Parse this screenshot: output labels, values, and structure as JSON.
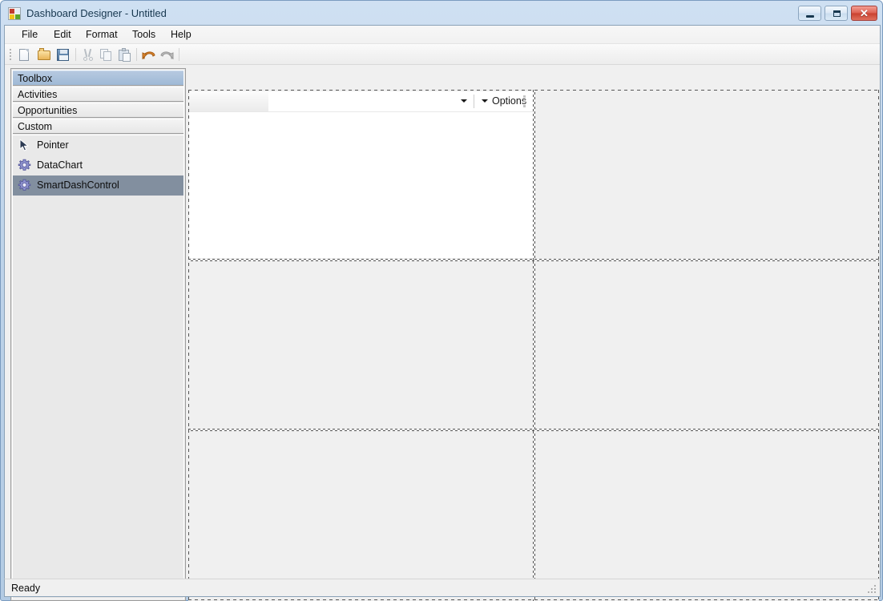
{
  "window": {
    "title": "Dashboard Designer - Untitled",
    "icon": "dashboard-app-icon",
    "controls": {
      "minimize": "Minimize",
      "maximize": "Maximize",
      "close": "Close"
    }
  },
  "menu": {
    "items": [
      {
        "label": "File"
      },
      {
        "label": "Edit"
      },
      {
        "label": "Format"
      },
      {
        "label": "Tools"
      },
      {
        "label": "Help"
      }
    ]
  },
  "toolbar": {
    "buttons": [
      {
        "icon": "new-document-icon",
        "tooltip": "New"
      },
      {
        "icon": "open-folder-icon",
        "tooltip": "Open"
      },
      {
        "icon": "save-floppy-icon",
        "tooltip": "Save"
      },
      {
        "icon": "cut-scissors-icon",
        "tooltip": "Cut"
      },
      {
        "icon": "copy-icon",
        "tooltip": "Copy"
      },
      {
        "icon": "paste-icon",
        "tooltip": "Paste"
      },
      {
        "icon": "undo-arrow-icon",
        "tooltip": "Undo"
      },
      {
        "icon": "redo-arrow-icon",
        "tooltip": "Redo"
      }
    ]
  },
  "toolbox": {
    "sections": [
      {
        "label": "Toolbox",
        "active": true
      },
      {
        "label": "Activities",
        "active": false
      },
      {
        "label": "Opportunities",
        "active": false
      },
      {
        "label": "Custom",
        "active": false
      }
    ],
    "items": [
      {
        "label": "Pointer",
        "icon": "pointer-arrow-icon",
        "selected": false
      },
      {
        "label": "DataChart",
        "icon": "gear-icon",
        "selected": false
      },
      {
        "label": "SmartDashControl",
        "icon": "gear-icon",
        "selected": true
      }
    ]
  },
  "surface": {
    "rows": 3,
    "columns": 2,
    "dash_control": {
      "combo_value": "",
      "combo_placeholder": "",
      "options_label": "Options",
      "options_dropdown_icon": "chevron-down-icon",
      "combo_dropdown_icon": "chevron-down-icon",
      "grip_icon": "grip-dots-icon"
    }
  },
  "status": {
    "text": "Ready",
    "resize_grip_icon": "resize-grip-icon"
  },
  "colors": {
    "window_border": "#7a9bbf",
    "title_text": "#17374f",
    "close_button": "#c9402f",
    "toolbox_active_header": "#9fb9d6",
    "toolbox_selected_item": "#828f9f",
    "surface_cell": "#f0f0f0",
    "dash_control_body": "#ffffff"
  }
}
